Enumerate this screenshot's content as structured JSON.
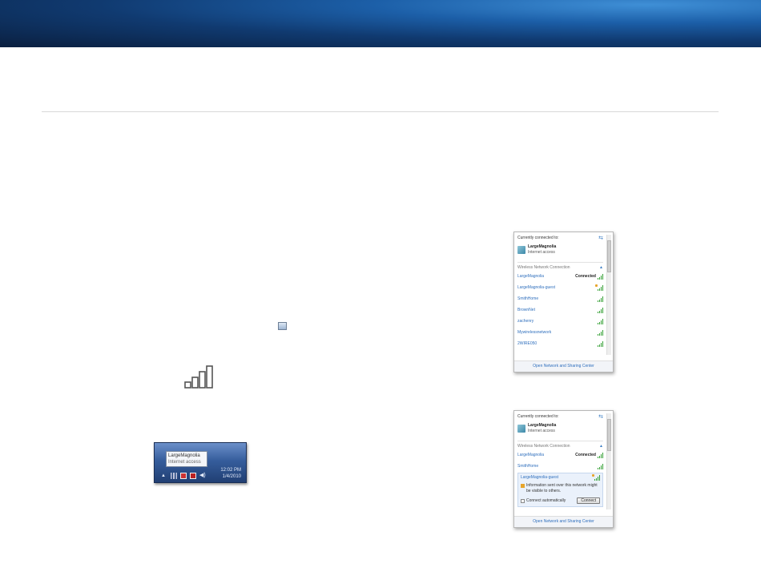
{
  "colors": {
    "banner_dark": "#0a1f3f",
    "banner_light": "#3f8fd6",
    "link_blue": "#2f6fbd",
    "signal_green": "#35a035"
  },
  "icons": {
    "tray": "network-tray-icon",
    "big_signal": "wireless-signal-bars-icon"
  },
  "taskbar": {
    "tooltip_title": "LargeMagnolia",
    "tooltip_subtitle": "Internet access",
    "time": "12:02 PM",
    "date": "1/4/2010"
  },
  "panel1": {
    "currently_connected_label": "Currently connected to:",
    "current_network": "LargeMagnolia",
    "current_status": "Internet access",
    "section_title": "Wireless Network Connection",
    "networks": [
      {
        "name": "LargeMagnolia",
        "status": "Connected",
        "secured": false
      },
      {
        "name": "LargeMagnolia-guest",
        "status": "",
        "secured": true
      },
      {
        "name": "SmithHome",
        "status": "",
        "secured": false
      },
      {
        "name": "BrownNet",
        "status": "",
        "secured": false
      },
      {
        "name": "zachenry",
        "status": "",
        "secured": false
      },
      {
        "name": "Mywirelessnetwork",
        "status": "",
        "secured": false
      },
      {
        "name": "2WIRE050",
        "status": "",
        "secured": false
      }
    ],
    "footer": "Open Network and Sharing Center"
  },
  "panel2": {
    "currently_connected_label": "Currently connected to:",
    "current_network": "LargeMagnolia",
    "current_status": "Internet access",
    "section_title": "Wireless Network Connection",
    "networks": [
      {
        "name": "LargeMagnolia",
        "status": "Connected",
        "secured": false
      },
      {
        "name": "SmithHome",
        "status": "",
        "secured": false
      }
    ],
    "expanded": {
      "name": "LargeMagnolia-guest",
      "warning": "Information sent over this network might be visible to others.",
      "auto_connect_label": "Connect automatically",
      "connect_button": "Connect"
    },
    "footer": "Open Network and Sharing Center"
  }
}
